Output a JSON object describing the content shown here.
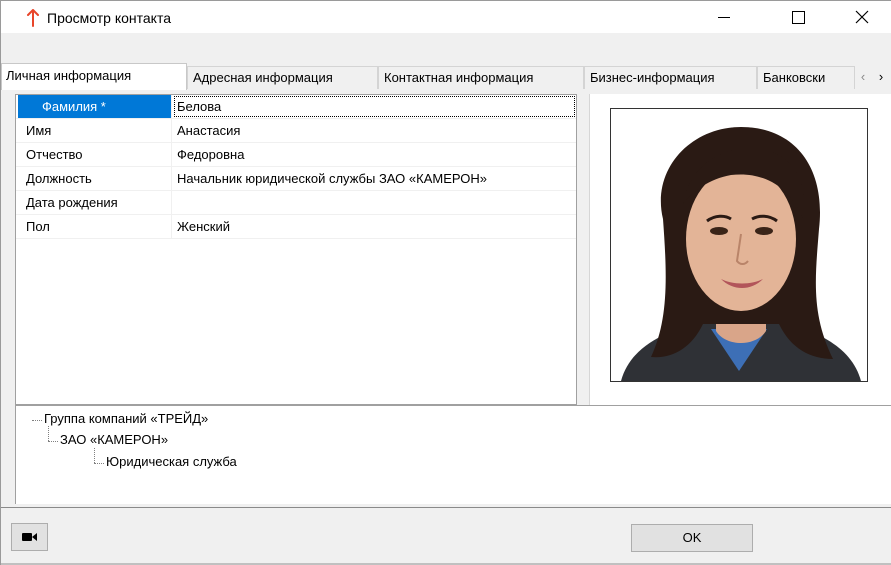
{
  "window": {
    "title": "Просмотр контакта",
    "minimize_label": "—",
    "close_label": "✕"
  },
  "tabs": [
    {
      "label": "Личная информация",
      "active": true
    },
    {
      "label": "Адресная информация",
      "active": false
    },
    {
      "label": "Контактная информация",
      "active": false
    },
    {
      "label": "Бизнес-информация",
      "active": false
    },
    {
      "label": "Банковски",
      "active": false
    }
  ],
  "tab_scroll": {
    "left": "‹",
    "right": "›"
  },
  "properties": [
    {
      "label": "Фамилия *",
      "value": "Белова",
      "selected": true
    },
    {
      "label": "Имя",
      "value": "Анастасия"
    },
    {
      "label": "Отчество",
      "value": "Федоровна"
    },
    {
      "label": "Должность",
      "value": "Начальник юридической службы ЗАО «КАМЕРОН»"
    },
    {
      "label": "Дата рождения",
      "value": ""
    },
    {
      "label": "Пол",
      "value": "Женский"
    }
  ],
  "tree": [
    {
      "label": "Группа компаний «ТРЕЙД»",
      "level": 0
    },
    {
      "label": "ЗАО «КАМЕРОН»",
      "level": 1
    },
    {
      "label": "Юридическая служба",
      "level": 2
    }
  ],
  "footer": {
    "ok_label": "OK",
    "camera_icon": "video-camera-icon"
  },
  "colors": {
    "selection": "#0078d7",
    "app_icon": "#e8452a"
  }
}
